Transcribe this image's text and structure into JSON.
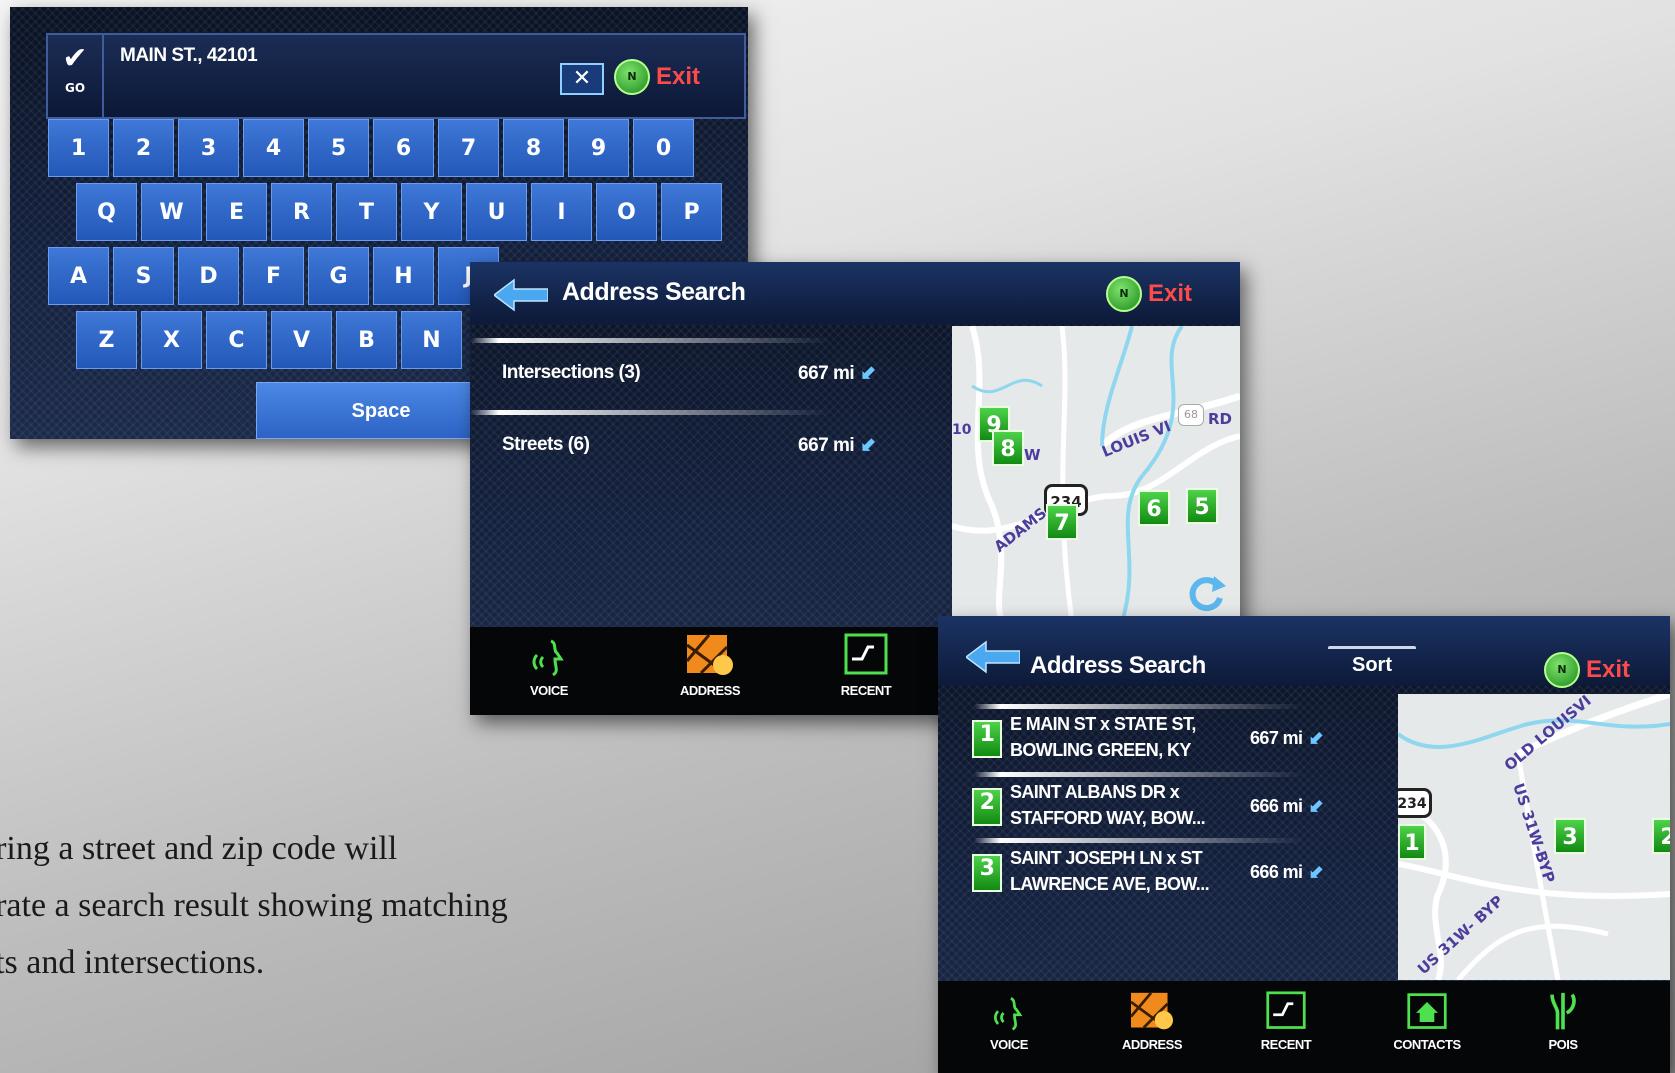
{
  "keyboard_screen": {
    "go_label": "GO",
    "entry_text": "MAIN ST., 42101",
    "exit_label": "Exit",
    "nav_badge": "N",
    "rows": [
      [
        "1",
        "2",
        "3",
        "4",
        "5",
        "6",
        "7",
        "8",
        "9",
        "0"
      ],
      [
        "Q",
        "W",
        "E",
        "R",
        "T",
        "Y",
        "U",
        "I",
        "O",
        "P"
      ],
      [
        "A",
        "S",
        "D",
        "F",
        "G",
        "H",
        "J"
      ],
      [
        "Z",
        "X",
        "C",
        "V",
        "B",
        "N"
      ]
    ],
    "space_label": "Space"
  },
  "search_screen_1": {
    "title": "Address Search",
    "exit_label": "Exit",
    "nav_badge": "N",
    "results": [
      {
        "label": "Intersections (3)",
        "distance": "667 mi"
      },
      {
        "label": "Streets (6)",
        "distance": "667 mi"
      }
    ],
    "map": {
      "road_labels": [
        "LOUIS VI",
        "RD",
        "ADAMS S",
        "10",
        "W"
      ],
      "route_shield": "234",
      "grey_shield": "68",
      "pins": [
        "9",
        "8",
        "7",
        "6",
        "5"
      ]
    },
    "bottom_bar": [
      {
        "label": "VOICE",
        "icon": "voice-icon"
      },
      {
        "label": "ADDRESS",
        "icon": "address-icon"
      },
      {
        "label": "RECENT",
        "icon": "recent-icon"
      }
    ]
  },
  "search_screen_2": {
    "title": "Address Search",
    "sort_label": "Sort",
    "exit_label": "Exit",
    "nav_badge": "N",
    "results": [
      {
        "number": "1",
        "line1": "E MAIN ST x STATE ST,",
        "line2": "BOWLING GREEN, KY",
        "distance": "667 mi"
      },
      {
        "number": "2",
        "line1": "SAINT ALBANS DR x",
        "line2": "STAFFORD WAY, BOW...",
        "distance": "666 mi"
      },
      {
        "number": "3",
        "line1": "SAINT JOSEPH LN x ST",
        "line2": "LAWRENCE AVE, BOW...",
        "distance": "666 mi"
      }
    ],
    "map": {
      "road_labels": [
        "OLD LOUISVI",
        "US 31W-BYP",
        "US 31W- BYP"
      ],
      "route_shield": "234",
      "pins": [
        "1",
        "3",
        "2"
      ]
    },
    "bottom_bar": [
      {
        "label": "VOICE",
        "icon": "voice-icon"
      },
      {
        "label": "ADDRESS",
        "icon": "address-icon"
      },
      {
        "label": "RECENT",
        "icon": "recent-icon"
      },
      {
        "label": "CONTACTS",
        "icon": "contacts-icon"
      },
      {
        "label": "POIS",
        "icon": "pois-icon"
      }
    ]
  },
  "caption": {
    "lines": [
      "ering a street and zip code will",
      "erate a search result showing matching",
      "ets and intersections."
    ]
  },
  "colors": {
    "key_blue": "#2f68c8",
    "pin_green": "#2eb82e",
    "exit_red": "#ff4a4a",
    "accent_cyan": "#6cc6ff"
  }
}
